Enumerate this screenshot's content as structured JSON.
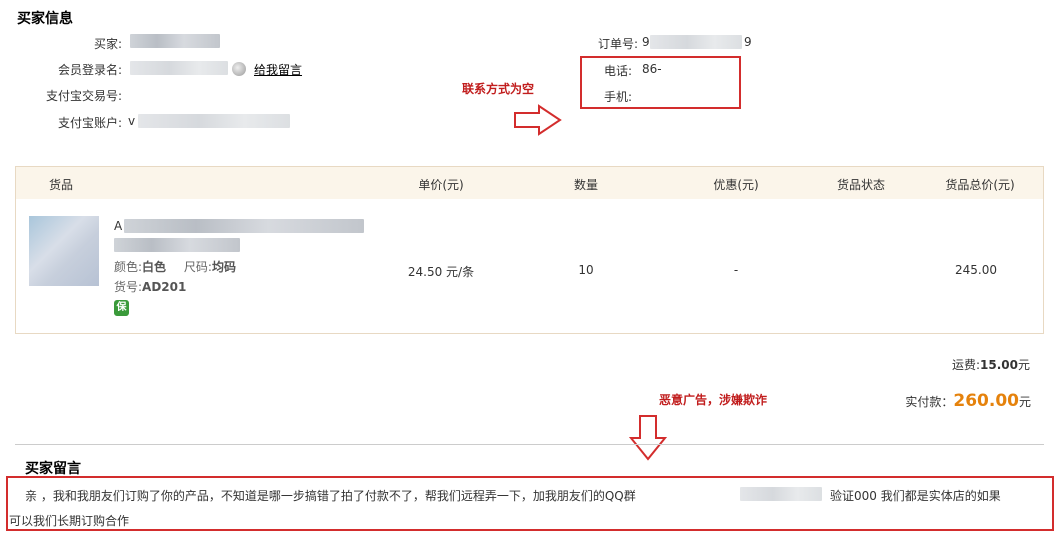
{
  "buyer_info": {
    "title": "买家信息",
    "buyer_label": "买家:",
    "member_label": "会员登录名:",
    "leave_message": "给我留言",
    "alipay_trade_label": "支付宝交易号:",
    "alipay_account_label": "支付宝账户:",
    "alipay_account_prefix": "v",
    "order_label": "订单号:",
    "order_prefix": "9",
    "order_suffix": "9",
    "phone_label": "电话:",
    "phone_value": "86-",
    "mobile_label": "手机:",
    "mobile_value": ""
  },
  "annotations": {
    "contact_empty": "联系方式为空",
    "malicious_ad": "恶意广告，涉嫌欺诈"
  },
  "goods": {
    "headers": [
      "货品",
      "单价(元)",
      "数量",
      "优惠(元)",
      "货品状态",
      "货品总价(元)"
    ],
    "item": {
      "title_prefix": "A",
      "color_label": "颜色:",
      "color_value": "白色",
      "size_label": "尺码:",
      "size_value": "均码",
      "sku_label": "货号:",
      "sku_value": "AD201",
      "badge": "保",
      "unit_price": "24.50 元/条",
      "quantity": "10",
      "discount": "-",
      "status": "",
      "total": "245.00"
    }
  },
  "summary": {
    "shipping_label": "运费:",
    "shipping_value": "15.00",
    "shipping_unit": "元",
    "paid_label": "实付款：",
    "paid_value": "260.00",
    "paid_unit": "元"
  },
  "buyer_message": {
    "title": "买家留言",
    "line1_a": "亲 ，我和我朋友们订购了你的产品，不知道是哪一步搞错了拍了付款不了，帮我们远程弄一下，加我朋友们的QQ群",
    "line1_b": "验证000 我们都是实体店的如果",
    "line2": "可以我们长期订购合作"
  },
  "colors": {
    "annotation_red": "#d32d2d",
    "paid_orange": "#e5820c",
    "header_bg": "#fbf5ea"
  }
}
